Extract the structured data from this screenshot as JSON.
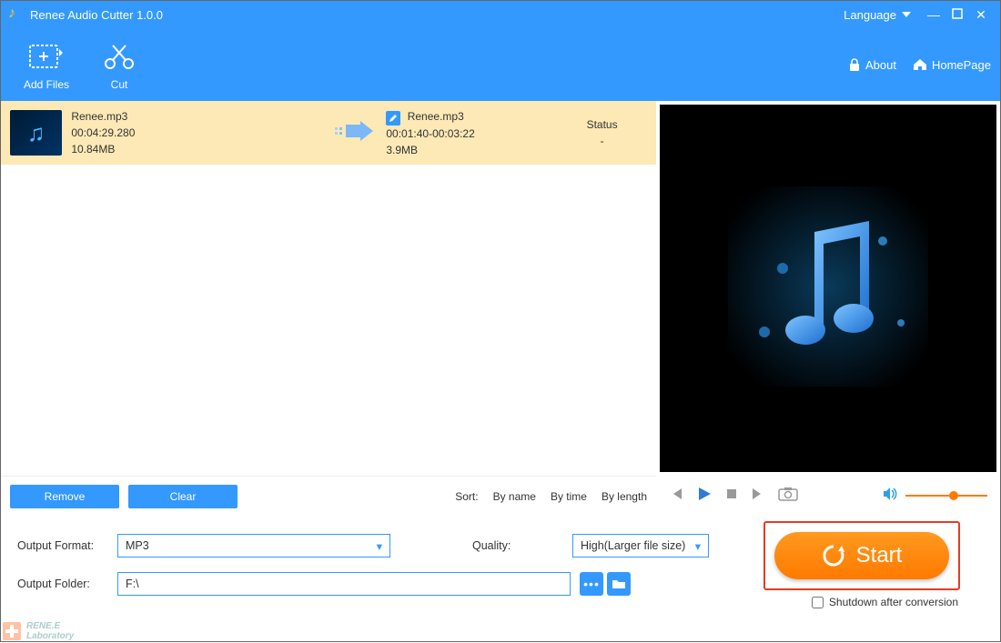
{
  "titlebar": {
    "title": "Renee Audio Cutter 1.0.0",
    "language": "Language"
  },
  "toolbar": {
    "addfiles": "Add Files",
    "cut": "Cut",
    "about": "About",
    "homepage": "HomePage"
  },
  "file": {
    "src_name": "Renee.mp3",
    "src_dur": "00:04:29.280",
    "src_size": "10.84MB",
    "out_name": "Renee.mp3",
    "out_range": "00:01:40-00:03:22",
    "out_size": "3.9MB",
    "status_label": "Status",
    "status_val": "-"
  },
  "listfooter": {
    "remove": "Remove",
    "clear": "Clear",
    "sort": "Sort:",
    "byname": "By name",
    "bytime": "By time",
    "bylength": "By length"
  },
  "bottom": {
    "format_label": "Output Format:",
    "format_val": "MP3",
    "quality_label": "Quality:",
    "quality_val": "High(Larger file size)",
    "folder_label": "Output Folder:",
    "folder_val": "F:\\",
    "start": "Start",
    "shutdown": "Shutdown after conversion"
  },
  "brand": {
    "line1": "RENE.E",
    "line2": "Laboratory"
  }
}
